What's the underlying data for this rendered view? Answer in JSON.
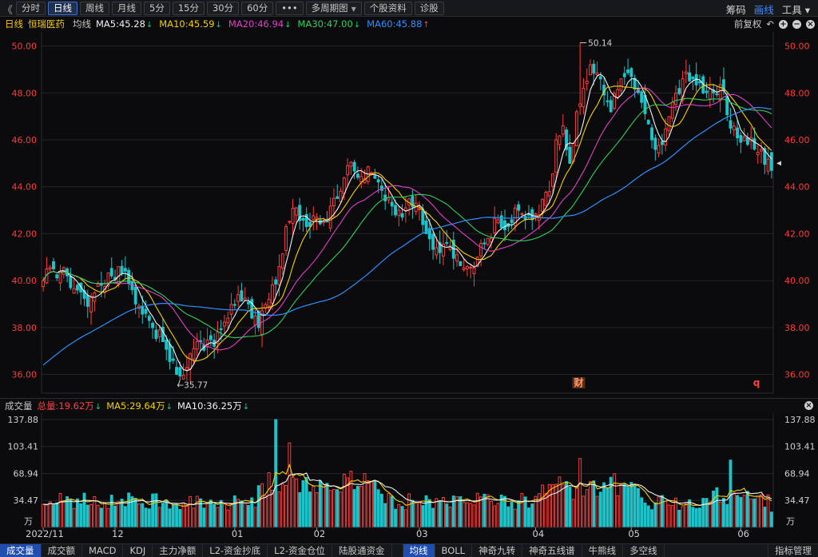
{
  "toolbar": {
    "back": "《",
    "buttons": [
      {
        "label": "分时",
        "active": false
      },
      {
        "label": "日线",
        "active": true
      },
      {
        "label": "周线",
        "active": false
      },
      {
        "label": "月线",
        "active": false
      },
      {
        "label": "5分",
        "active": false
      },
      {
        "label": "15分",
        "active": false
      },
      {
        "label": "30分",
        "active": false
      },
      {
        "label": "60分",
        "active": false
      },
      {
        "label": "•••",
        "active": false
      },
      {
        "label": "多周期图",
        "active": false,
        "dropdown": true
      },
      {
        "label": "个股资料",
        "active": false,
        "icon": "document-icon"
      },
      {
        "label": "诊股",
        "active": false,
        "icon": "checklist-icon"
      }
    ],
    "right": [
      {
        "label": "筹码",
        "active": false
      },
      {
        "label": "画线",
        "active": true
      },
      {
        "label": "工具",
        "active": false,
        "dropdown": true
      }
    ]
  },
  "ma_legend": {
    "period": "日线",
    "stock_name": "恒瑞医药",
    "label": "均线",
    "items": [
      {
        "label": "MA5:45.28",
        "arrow": "down",
        "color": "#f2f2f2"
      },
      {
        "label": "MA10:45.59",
        "arrow": "down",
        "color": "#f5d000"
      },
      {
        "label": "MA20:46.94",
        "arrow": "down",
        "color": "#e040c8"
      },
      {
        "label": "MA30:47.00",
        "arrow": "down",
        "color": "#2fd15e"
      },
      {
        "label": "MA60:45.88",
        "arrow": "up",
        "color": "#2f8fff"
      }
    ],
    "right_label": "前复权"
  },
  "colors": {
    "up": "#ff3b3b",
    "down": "#1dc3c8",
    "axis_text": "#ff3b3b",
    "grid": "#23242a",
    "ma5": "#f2f2f2",
    "ma10": "#f5d000",
    "ma20": "#e040c8",
    "ma30": "#2fd15e",
    "ma60": "#2f8fff",
    "background": "#0b0b0d"
  },
  "chart_data": [
    {
      "type": "candlestick",
      "ylim": [
        35.2,
        50.6
      ],
      "yticks": [
        "50.00",
        "48.00",
        "46.00",
        "44.00",
        "42.00",
        "40.00",
        "38.00",
        "36.00"
      ],
      "grid": true,
      "annotations": [
        {
          "text": "50.14",
          "kind": "high"
        },
        {
          "text": "35.77",
          "kind": "low"
        },
        {
          "text": "财",
          "kind": "event"
        },
        {
          "text": "q",
          "kind": "event"
        }
      ],
      "months": [
        "2022/11",
        "12",
        "01",
        "02",
        "03",
        "04",
        "05",
        "06"
      ],
      "month_index": [
        0,
        21,
        56,
        80,
        110,
        144,
        172,
        204
      ],
      "bar_count": 214,
      "anchors": [
        [
          0,
          40.0
        ],
        [
          3,
          40.5
        ],
        [
          7,
          40.2
        ],
        [
          10,
          39.6
        ],
        [
          13,
          38.9
        ],
        [
          17,
          39.8
        ],
        [
          20,
          40.2
        ],
        [
          24,
          40.4
        ],
        [
          27,
          39.0
        ],
        [
          31,
          38.3
        ],
        [
          35,
          37.4
        ],
        [
          39,
          36.0
        ],
        [
          42,
          36.3
        ],
        [
          46,
          37.4
        ],
        [
          50,
          37.2
        ],
        [
          54,
          38.4
        ],
        [
          57,
          39.4
        ],
        [
          60,
          39.0
        ],
        [
          63,
          38.0
        ],
        [
          66,
          39.2
        ],
        [
          69,
          40.6
        ],
        [
          71,
          42.3
        ],
        [
          74,
          43.1
        ],
        [
          77,
          42.3
        ],
        [
          80,
          42.7
        ],
        [
          83,
          42.5
        ],
        [
          86,
          43.5
        ],
        [
          89,
          44.9
        ],
        [
          92,
          44.4
        ],
        [
          96,
          44.6
        ],
        [
          100,
          43.4
        ],
        [
          103,
          42.8
        ],
        [
          106,
          43.1
        ],
        [
          109,
          43.3
        ],
        [
          112,
          42.0
        ],
        [
          115,
          41.4
        ],
        [
          118,
          41.6
        ],
        [
          121,
          41.1
        ],
        [
          124,
          40.6
        ],
        [
          127,
          41.0
        ],
        [
          130,
          41.8
        ],
        [
          133,
          42.6
        ],
        [
          136,
          42.3
        ],
        [
          139,
          43.0
        ],
        [
          142,
          42.8
        ],
        [
          145,
          42.8
        ],
        [
          148,
          43.8
        ],
        [
          150,
          46.0
        ],
        [
          152,
          46.6
        ],
        [
          154,
          45.0
        ],
        [
          156,
          47.2
        ],
        [
          158,
          48.2
        ],
        [
          160,
          49.2
        ],
        [
          163,
          48.6
        ],
        [
          166,
          47.2
        ],
        [
          169,
          48.6
        ],
        [
          172,
          48.7
        ],
        [
          175,
          47.6
        ],
        [
          178,
          46.0
        ],
        [
          181,
          45.8
        ],
        [
          184,
          47.6
        ],
        [
          187,
          48.6
        ],
        [
          190,
          48.6
        ],
        [
          193,
          48.0
        ],
        [
          196,
          48.0
        ],
        [
          199,
          48.1
        ],
        [
          201,
          46.5
        ],
        [
          204,
          45.9
        ],
        [
          207,
          46.1
        ],
        [
          210,
          45.6
        ],
        [
          213,
          44.7
        ]
      ],
      "high": {
        "bar": 157,
        "value": 50.14
      },
      "low": {
        "bar": 40,
        "value": 35.77
      }
    },
    {
      "type": "bar",
      "name": "成交量",
      "ylim": [
        0,
        146
      ],
      "yticks": [
        "137.88",
        "103.41",
        "68.94",
        "34.47"
      ],
      "unit": "万",
      "peaks": [
        [
          68,
          137.88
        ],
        [
          72,
          108
        ],
        [
          157,
          88
        ],
        [
          201,
          86
        ],
        [
          213,
          19.62
        ]
      ]
    }
  ],
  "volume_legend": {
    "label": "成交量",
    "total": "总量:19.62万",
    "total_arrow": "down",
    "ma5": "MA5:29.64万",
    "ma5_arrow": "down",
    "ma10": "MA10:36.25万",
    "ma10_arrow": "down"
  },
  "bottom_tabs": {
    "left": [
      {
        "label": "成交量",
        "active": true
      },
      {
        "label": "成交额",
        "active": false
      },
      {
        "label": "MACD",
        "active": false
      },
      {
        "label": "KDJ",
        "active": false
      },
      {
        "label": "主力净额",
        "active": false
      },
      {
        "label": "L2-资金抄底",
        "active": false
      },
      {
        "label": "L2-资金仓位",
        "active": false
      },
      {
        "label": "陆股通资金",
        "active": false
      }
    ],
    "right_group": [
      {
        "label": "均线",
        "active": true
      },
      {
        "label": "BOLL",
        "active": false
      },
      {
        "label": "神奇九转",
        "active": false
      },
      {
        "label": "神奇五线谱",
        "active": false
      },
      {
        "label": "牛熊线",
        "active": false
      },
      {
        "label": "多空线",
        "active": false
      }
    ],
    "manage": "指标管理"
  }
}
